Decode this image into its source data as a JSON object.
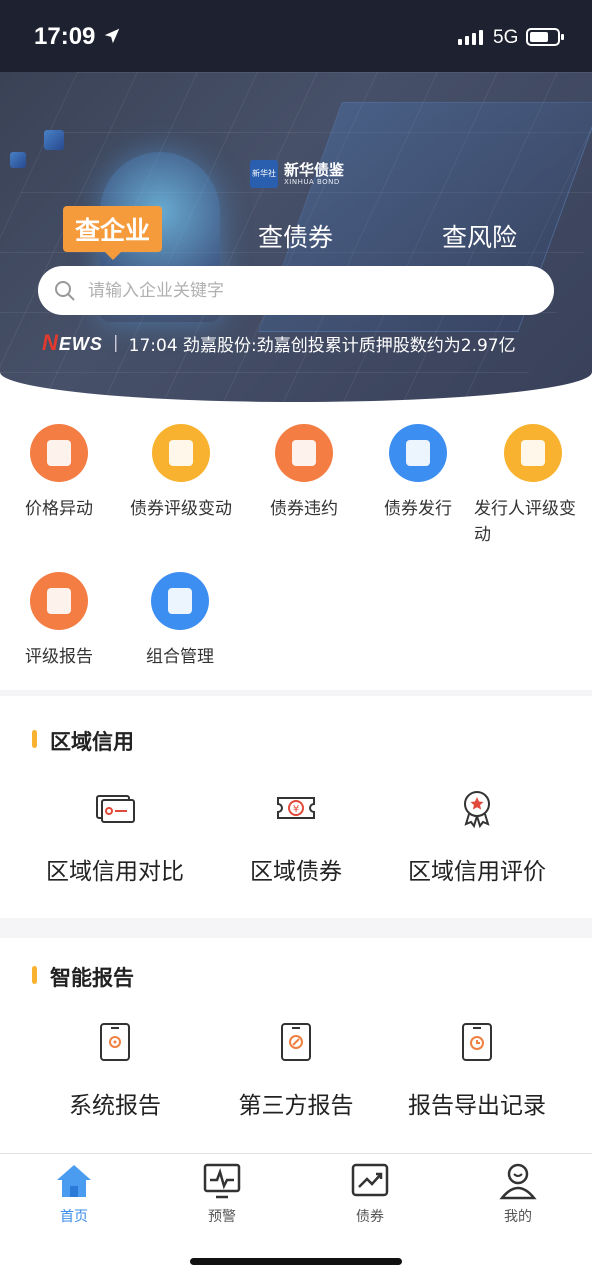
{
  "status": {
    "time": "17:09",
    "network": "5G"
  },
  "brand": {
    "logo_text": "新华社",
    "name": "新华债鉴",
    "sub": "XINHUA BOND"
  },
  "search_tabs": [
    "查企业",
    "查债券",
    "查风险"
  ],
  "search": {
    "placeholder": "请输入企业关键字",
    "value": ""
  },
  "news": {
    "logo": "NEWS",
    "text": "17:04 劲嘉股份:劲嘉创投累计质押股数约为2.97亿"
  },
  "menu": [
    {
      "label": "价格异动",
      "icon": "money-bag-icon",
      "color": "#f47d43"
    },
    {
      "label": "债券评级变动",
      "icon": "rating-change-icon",
      "color": "#f8b22f"
    },
    {
      "label": "债券违约",
      "icon": "default-ticket-icon",
      "color": "#f47d43"
    },
    {
      "label": "债券发行",
      "icon": "chart-issue-icon",
      "color": "#3d8ef1"
    },
    {
      "label": "发行人评级变动",
      "icon": "issuer-rating-icon",
      "color": "#f8b22f"
    },
    {
      "label": "评级报告",
      "icon": "clipboard-star-icon",
      "color": "#f47d43"
    },
    {
      "label": "组合管理",
      "icon": "bar-chart-icon",
      "color": "#3d8ef1"
    }
  ],
  "region": {
    "title": "区域信用",
    "items": [
      {
        "label": "区域信用对比",
        "icon": "card-compare-icon"
      },
      {
        "label": "区域债券",
        "icon": "yen-ticket-icon"
      },
      {
        "label": "区域信用评价",
        "icon": "award-badge-icon"
      }
    ]
  },
  "report": {
    "title": "智能报告",
    "items": [
      {
        "label": "系统报告",
        "icon": "gear-doc-icon"
      },
      {
        "label": "第三方报告",
        "icon": "link-doc-icon"
      },
      {
        "label": "报告导出记录",
        "icon": "history-doc-icon"
      }
    ]
  },
  "tabbar": [
    {
      "label": "首页",
      "icon": "home-icon",
      "active": true
    },
    {
      "label": "预警",
      "icon": "pulse-monitor-icon",
      "active": false
    },
    {
      "label": "债券",
      "icon": "trend-chart-icon",
      "active": false
    },
    {
      "label": "我的",
      "icon": "user-icon",
      "active": false
    }
  ],
  "colors": {
    "accent_orange": "#f59b3c",
    "accent_yellow": "#f8b22f",
    "active_blue": "#3a8de8",
    "news_red": "#e23a2e"
  }
}
